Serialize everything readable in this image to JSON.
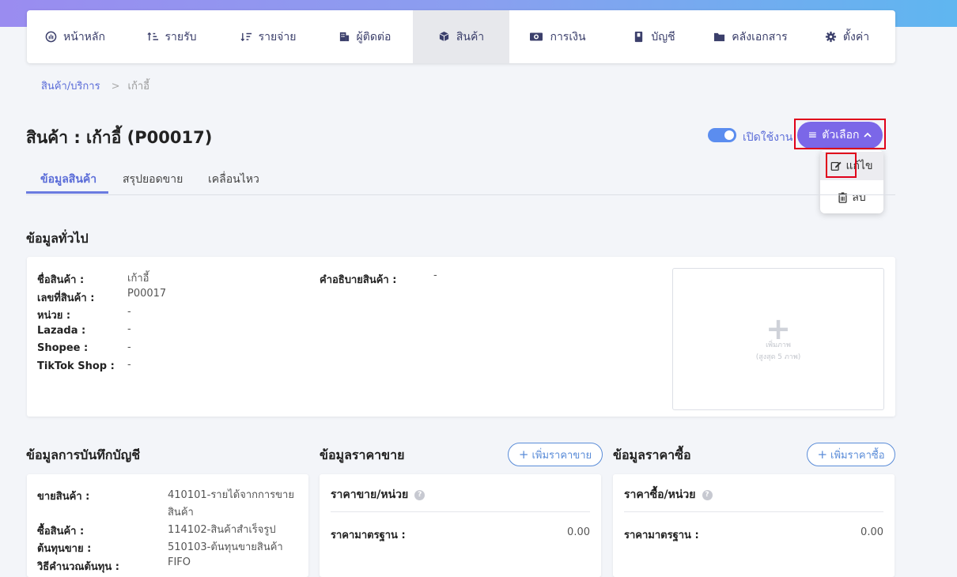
{
  "nav": [
    {
      "label": "หน้าหลัก",
      "icon": "dashboard-icon"
    },
    {
      "label": "รายรับ",
      "icon": "income-sort-icon"
    },
    {
      "label": "รายจ่าย",
      "icon": "expense-sort-icon"
    },
    {
      "label": "ผู้ติดต่อ",
      "icon": "building-icon"
    },
    {
      "label": "สินค้า",
      "icon": "box-icon"
    },
    {
      "label": "การเงิน",
      "icon": "money-icon"
    },
    {
      "label": "บัญชี",
      "icon": "book-icon"
    },
    {
      "label": "คลังเอกสาร",
      "icon": "folder-icon"
    },
    {
      "label": "ตั้งค่า",
      "icon": "gear-icon"
    }
  ],
  "breadcrumb": {
    "parent": "สินค้า/บริการ",
    "separator": ">",
    "current": "เก้าอี้"
  },
  "page_title": "สินค้า : เก้าอี้ (P00017)",
  "toggle": {
    "label": "เปิดใช้งาน",
    "on": true
  },
  "options_button": "ตัวเลือก",
  "dropdown": {
    "edit": "แก้ไข",
    "delete": "ลบ"
  },
  "tabs": [
    "ข้อมูลสินค้า",
    "สรุปยอดขาย",
    "เคลื่อนไหว"
  ],
  "general": {
    "title": "ข้อมูลทั่วไป",
    "fields": [
      {
        "label": "ชื่อสินค้า :",
        "value": "เก้าอี้"
      },
      {
        "label": "เลขที่สินค้า :",
        "value": "P00017"
      },
      {
        "label": "หน่วย :",
        "value": "-"
      },
      {
        "label": "Lazada :",
        "value": "-"
      },
      {
        "label": "Shopee :",
        "value": "-"
      },
      {
        "label": "TikTok Shop :",
        "value": "-"
      }
    ],
    "description_label": "คำอธิบายสินค้า :",
    "description_value": "-",
    "image_hint_1": "เพิ่มภาพ",
    "image_hint_2": "(สูงสุด 5 ภาพ)"
  },
  "accounting": {
    "title": "ข้อมูลการบันทึกบัญชี",
    "fields": [
      {
        "label": "ขายสินค้า :",
        "value_1": "410101-รายได้จากการขาย",
        "value_2": "สินค้า"
      },
      {
        "label": "ซื้อสินค้า :",
        "value": "114102-สินค้าสำเร็จรูป"
      },
      {
        "label": "ต้นทุนขาย :",
        "value": "510103-ต้นทุนขายสินค้า"
      },
      {
        "label": "วิธีคำนวณต้นทุน :",
        "value": "FIFO"
      }
    ]
  },
  "sale_price": {
    "title": "ข้อมูลราคาขาย",
    "add_button": "เพิ่มราคาขาย",
    "subheading": "ราคาขาย/หน่วย",
    "std_label": "ราคามาตรฐาน :",
    "std_value": "0.00"
  },
  "buy_price": {
    "title": "ข้อมูลราคาซื้อ",
    "add_button": "เพิ่มราคาซื้อ",
    "subheading": "ราคาซื้อ/หน่วย",
    "std_label": "ราคามาตรฐาน :",
    "std_value": "0.00"
  }
}
